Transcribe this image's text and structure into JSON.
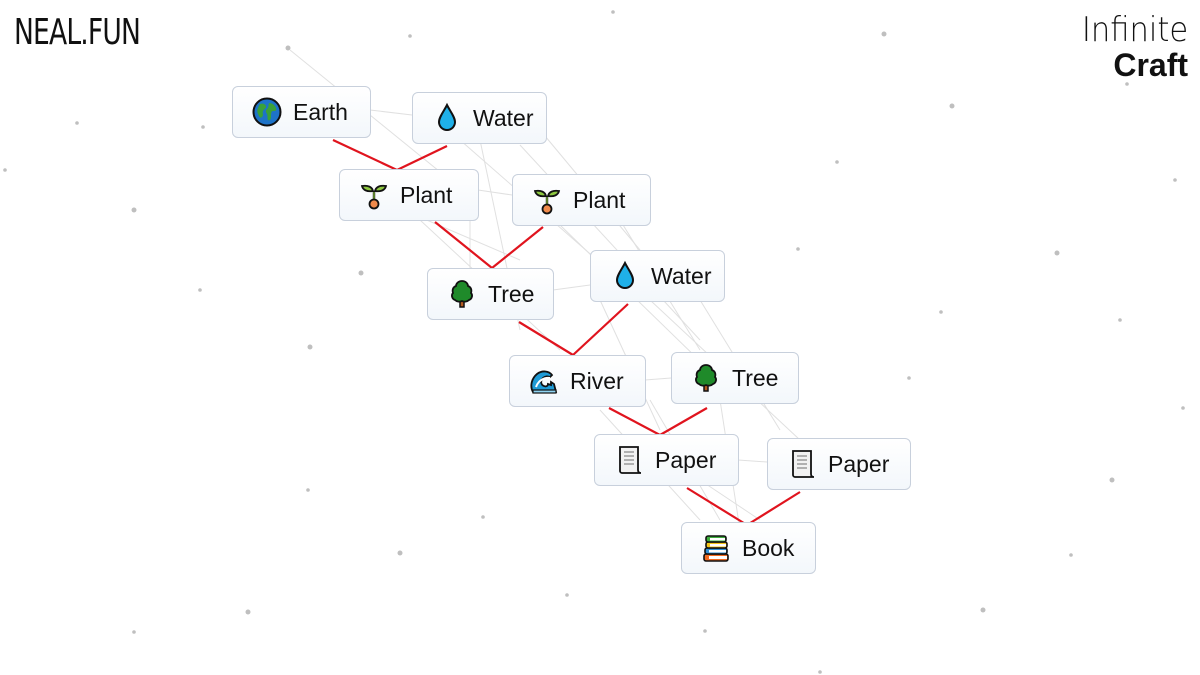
{
  "header": {
    "site_logo": "NEAL.FUN",
    "game_title_line1": "Infinite",
    "game_title_line2": "Craft"
  },
  "canvas": {
    "items": [
      {
        "id": "earth",
        "label": "Earth",
        "icon": "globe-europe-africa-icon"
      },
      {
        "id": "water1",
        "label": "Water",
        "icon": "water-droplet-icon"
      },
      {
        "id": "plant1",
        "label": "Plant",
        "icon": "seedling-icon"
      },
      {
        "id": "plant2",
        "label": "Plant",
        "icon": "seedling-icon"
      },
      {
        "id": "tree1",
        "label": "Tree",
        "icon": "deciduous-tree-icon"
      },
      {
        "id": "water2",
        "label": "Water",
        "icon": "water-droplet-icon"
      },
      {
        "id": "river",
        "label": "River",
        "icon": "water-wave-icon"
      },
      {
        "id": "tree2",
        "label": "Tree",
        "icon": "deciduous-tree-icon"
      },
      {
        "id": "paper1",
        "label": "Paper",
        "icon": "page-curl-icon"
      },
      {
        "id": "paper2",
        "label": "Paper",
        "icon": "page-curl-icon"
      },
      {
        "id": "book",
        "label": "Book",
        "icon": "books-icon"
      }
    ],
    "combinations": [
      {
        "inputs": [
          "Earth",
          "Water"
        ],
        "result": "Plant"
      },
      {
        "inputs": [
          "Plant",
          "Plant"
        ],
        "result": "Tree"
      },
      {
        "inputs": [
          "Tree",
          "Water"
        ],
        "result": "River"
      },
      {
        "inputs": [
          "River",
          "Tree"
        ],
        "result": "Paper"
      },
      {
        "inputs": [
          "Paper",
          "Paper"
        ],
        "result": "Book"
      }
    ],
    "colors": {
      "connector": "#e0141e",
      "item_border": "#c8d0dc",
      "background": "#ffffff"
    }
  }
}
